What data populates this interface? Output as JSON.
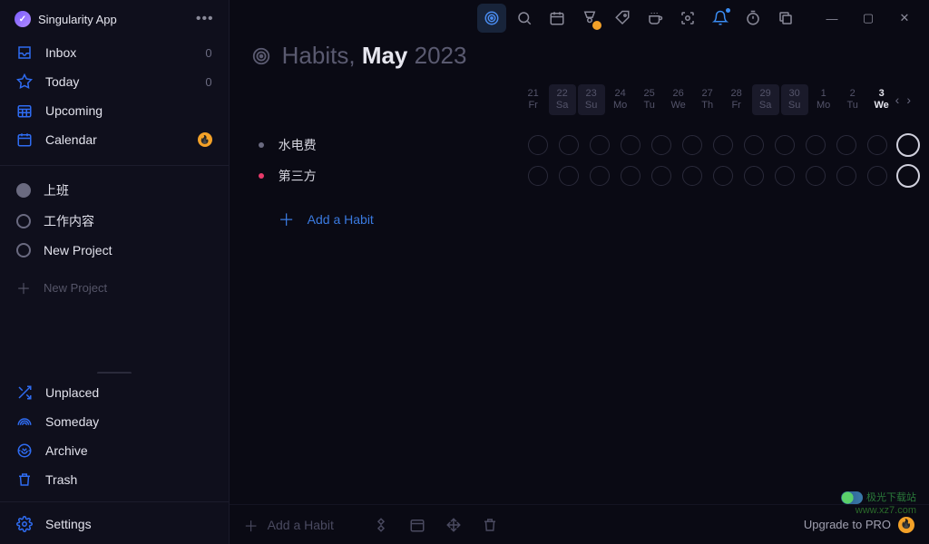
{
  "app": {
    "title": "Singularity App",
    "more": "•••"
  },
  "sidebar": {
    "nav": [
      {
        "label": "Inbox",
        "count": "0",
        "icon": "inbox-icon"
      },
      {
        "label": "Today",
        "count": "0",
        "icon": "star-icon"
      },
      {
        "label": "Upcoming",
        "count": "",
        "icon": "calendar-grid-icon"
      },
      {
        "label": "Calendar",
        "count": "",
        "icon": "calendar-icon",
        "fire": true
      }
    ],
    "projects": [
      {
        "label": "上班",
        "solid": true
      },
      {
        "label": "工作内容",
        "solid": false
      },
      {
        "label": "New Project",
        "solid": false
      }
    ],
    "new_project": "New Project",
    "bottom": [
      {
        "label": "Unplaced",
        "icon": "shuffle-icon"
      },
      {
        "label": "Someday",
        "icon": "rainbow-icon"
      },
      {
        "label": "Archive",
        "icon": "archive-icon"
      },
      {
        "label": "Trash",
        "icon": "trash-icon"
      }
    ],
    "settings": "Settings"
  },
  "habits": {
    "title_prefix": "Habits, ",
    "month": "May",
    "year": " 2023",
    "days": [
      {
        "num": "21",
        "wd": "Fr"
      },
      {
        "num": "22",
        "wd": "Sa",
        "hilite": true
      },
      {
        "num": "23",
        "wd": "Su",
        "hilite": true
      },
      {
        "num": "24",
        "wd": "Mo"
      },
      {
        "num": "25",
        "wd": "Tu"
      },
      {
        "num": "26",
        "wd": "We"
      },
      {
        "num": "27",
        "wd": "Th"
      },
      {
        "num": "28",
        "wd": "Fr"
      },
      {
        "num": "29",
        "wd": "Sa",
        "hilite": true
      },
      {
        "num": "30",
        "wd": "Su",
        "hilite": true
      },
      {
        "num": "1",
        "wd": "Mo"
      },
      {
        "num": "2",
        "wd": "Tu"
      },
      {
        "num": "3",
        "wd": "We",
        "today": true
      }
    ],
    "list": [
      {
        "name": "水电费",
        "color": "#6a6a80"
      },
      {
        "name": "第三方",
        "color": "#e83a6a"
      }
    ],
    "add_label": "Add a Habit"
  },
  "bottom_bar": {
    "add_label": "Add a Habit",
    "upgrade": "Upgrade to PRO"
  },
  "watermark": {
    "l1": "极光下载站",
    "l2": "www.xz7.com"
  }
}
